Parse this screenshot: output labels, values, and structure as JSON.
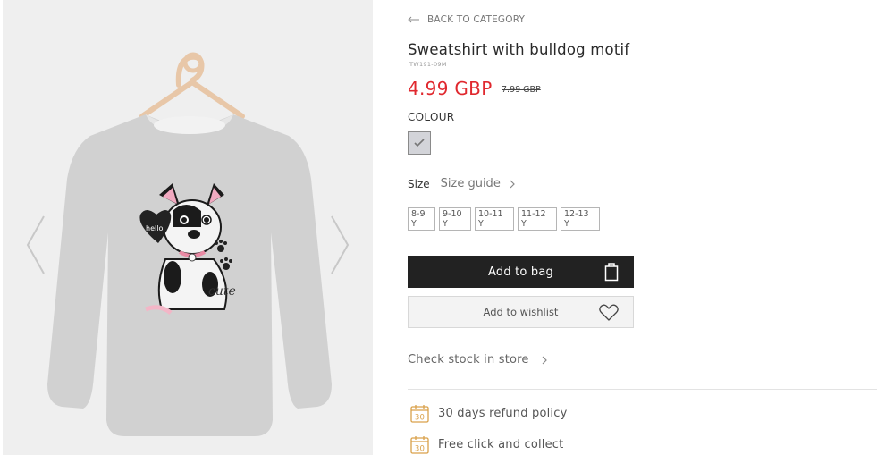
{
  "nav": {
    "back_label": "BACK TO CATEGORY"
  },
  "product": {
    "title": "Sweatshirt with bulldog motif",
    "sku": "TW191-09M",
    "price": "4.99 GBP",
    "old_price": "7.99 GBP",
    "accent_color": "#e0282e",
    "image_text": {
      "hello": "hello",
      "cute": "cute"
    }
  },
  "colour": {
    "label": "COLOUR",
    "swatch_color": "#d3d4d9"
  },
  "size": {
    "label": "Size",
    "guide_label": "Size guide",
    "options": [
      "8-9 Y",
      "9-10 Y",
      "10-11 Y",
      "11-12 Y",
      "12-13 Y"
    ]
  },
  "actions": {
    "add_to_bag": "Add to bag",
    "add_to_wishlist": "Add to wishlist",
    "check_stock": "Check stock in store"
  },
  "perks": [
    {
      "icon": "calendar-30-icon",
      "badge": "30",
      "label": "30 days refund policy"
    },
    {
      "icon": "calendar-30-icon",
      "badge": "30",
      "label": "Free click and collect"
    }
  ]
}
